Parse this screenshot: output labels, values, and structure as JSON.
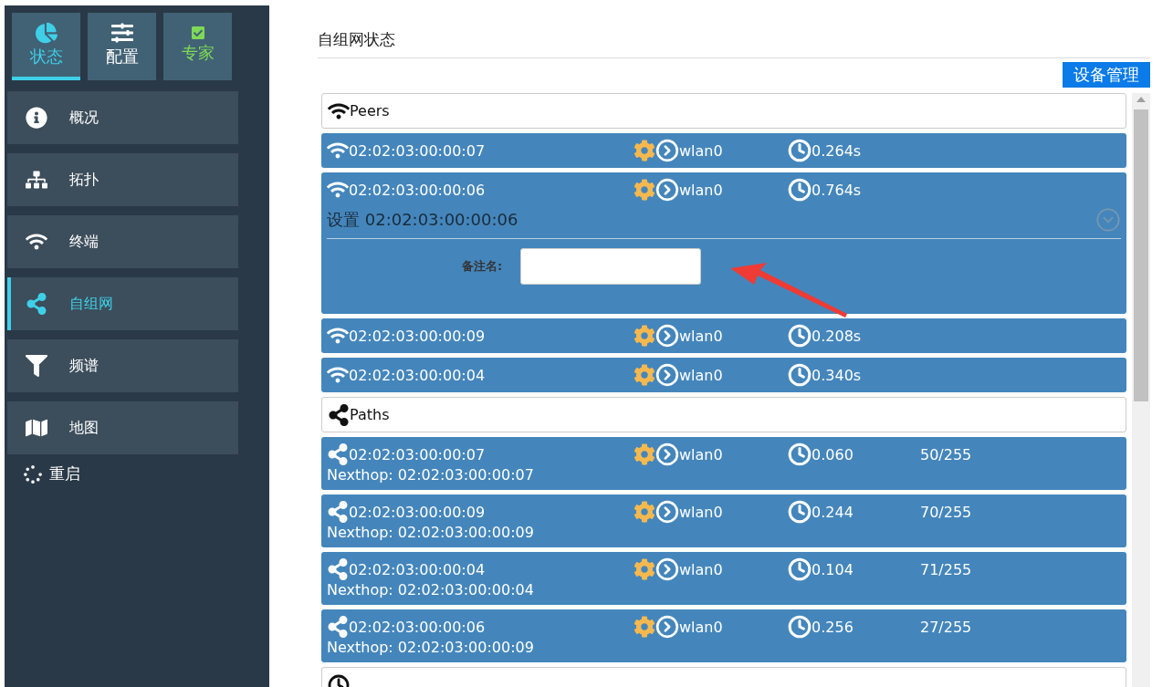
{
  "sidebar": {
    "tabs": [
      {
        "label": "状态",
        "kind": "pie",
        "selected": true,
        "color": "#3fd0e8"
      },
      {
        "label": "配置",
        "kind": "sliders",
        "selected": false,
        "color": "#ffffff"
      },
      {
        "label": "专家",
        "kind": "check",
        "selected": false,
        "color": "#7ed957"
      }
    ],
    "items": [
      {
        "label": "概况",
        "kind": "info",
        "selected": false
      },
      {
        "label": "拓扑",
        "kind": "sitemap",
        "selected": false
      },
      {
        "label": "终端",
        "kind": "wifi",
        "selected": false
      },
      {
        "label": "自组网",
        "kind": "share",
        "selected": true
      },
      {
        "label": "频谱",
        "kind": "filter",
        "selected": false
      },
      {
        "label": "地图",
        "kind": "map",
        "selected": false
      }
    ],
    "reboot": {
      "label": "重启"
    }
  },
  "main": {
    "title": "自组网状态",
    "button": "设备管理",
    "sections": [
      {
        "kind": "peers",
        "title": "Peers",
        "rows": [
          {
            "mac": "02:02:03:00:00:07",
            "iface": "wlan0",
            "time": "0.264s",
            "expanded": false
          },
          {
            "mac": "02:02:03:00:00:06",
            "iface": "wlan0",
            "time": "0.764s",
            "expanded": true,
            "settings_title": "设置 02:02:03:00:00:06",
            "note_label": "备注名:"
          },
          {
            "mac": "02:02:03:00:00:09",
            "iface": "wlan0",
            "time": "0.208s",
            "expanded": false
          },
          {
            "mac": "02:02:03:00:00:04",
            "iface": "wlan0",
            "time": "0.340s",
            "expanded": false
          }
        ]
      },
      {
        "kind": "paths",
        "title": "Paths",
        "rows": [
          {
            "mac": "02:02:03:00:00:07",
            "iface": "wlan0",
            "time": "0.060",
            "metric": "50/255",
            "nexthop": "Nexthop: 02:02:03:00:00:07"
          },
          {
            "mac": "02:02:03:00:00:09",
            "iface": "wlan0",
            "time": "0.244",
            "metric": "70/255",
            "nexthop": "Nexthop: 02:02:03:00:00:09"
          },
          {
            "mac": "02:02:03:00:00:04",
            "iface": "wlan0",
            "time": "0.104",
            "metric": "71/255",
            "nexthop": "Nexthop: 02:02:03:00:00:04"
          },
          {
            "mac": "02:02:03:00:00:06",
            "iface": "wlan0",
            "time": "0.256",
            "metric": "27/255",
            "nexthop": "Nexthop: 02:02:03:00:00:09"
          }
        ]
      },
      {
        "kind": "clock"
      }
    ]
  }
}
